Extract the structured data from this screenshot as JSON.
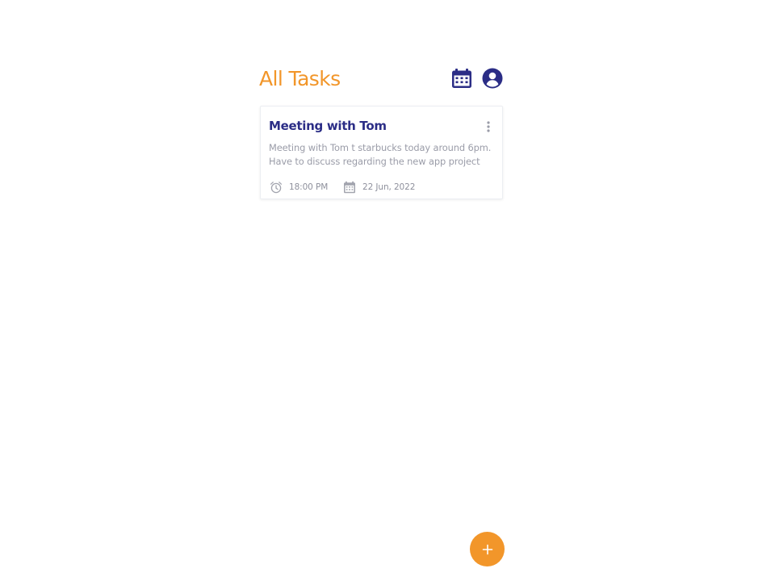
{
  "colors": {
    "accent_orange": "#f2962a",
    "brand_navy": "#2b2d86",
    "muted_gray": "#9a9ca8",
    "meta_icon_gray": "#a2a4ae"
  },
  "header": {
    "title": "All Tasks",
    "calendar_icon": "calendar-icon",
    "profile_icon": "account-circle-icon"
  },
  "tasks": [
    {
      "title": "Meeting with Tom",
      "description_lines": [
        "Meeting with Tom t starbucks today around 6pm.",
        "Have to discuss regarding the new app project"
      ],
      "time_icon": "alarm-clock-icon",
      "time": "18:00 PM",
      "date_icon": "calendar-icon",
      "date": "22 Jun, 2022",
      "menu_icon": "more-vertical-icon"
    }
  ],
  "fab": {
    "label": "+",
    "icon": "plus-icon"
  }
}
